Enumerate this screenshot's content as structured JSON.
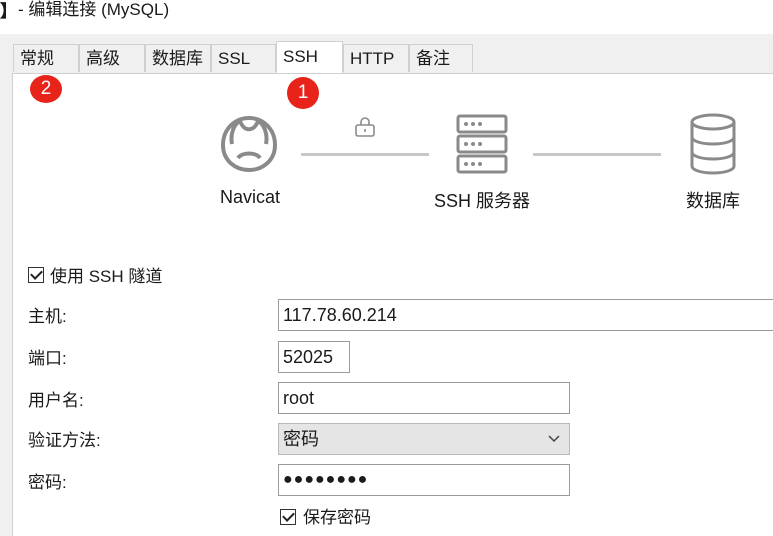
{
  "window": {
    "title_icon": "】",
    "title": " - 编辑连接 (MySQL)"
  },
  "tabs": [
    {
      "label": "常规"
    },
    {
      "label": "高级"
    },
    {
      "label": "数据库"
    },
    {
      "label": "SSL"
    },
    {
      "label": "SSH"
    },
    {
      "label": "HTTP"
    },
    {
      "label": "备注"
    }
  ],
  "active_tab": "SSH",
  "badges": [
    {
      "number": "1",
      "target": "SSH"
    },
    {
      "number": "2",
      "target": "常规"
    }
  ],
  "diagram": {
    "nodes": [
      {
        "label": "Navicat",
        "icon": "navicat-logo-icon"
      },
      {
        "label": "SSH 服务器",
        "icon": "server-icon"
      },
      {
        "label": "数据库",
        "icon": "database-icon"
      }
    ],
    "lock_icon": "lock-icon"
  },
  "form": {
    "use_ssh_label": "使用 SSH 隧道",
    "use_ssh_checked": true,
    "host_label": "主机:",
    "host_value": "117.78.60.214",
    "port_label": "端口:",
    "port_value": "52025",
    "username_label": "用户名:",
    "username_value": "root",
    "auth_label": "验证方法:",
    "auth_value": "密码",
    "password_label": "密码:",
    "password_value": "●●●●●●●●",
    "save_password_label": "保存密码",
    "save_password_checked": true
  },
  "colors": {
    "badge": "#e8231a",
    "icon": "#8a8a8a",
    "active_tab_bg": "#ffffff"
  }
}
